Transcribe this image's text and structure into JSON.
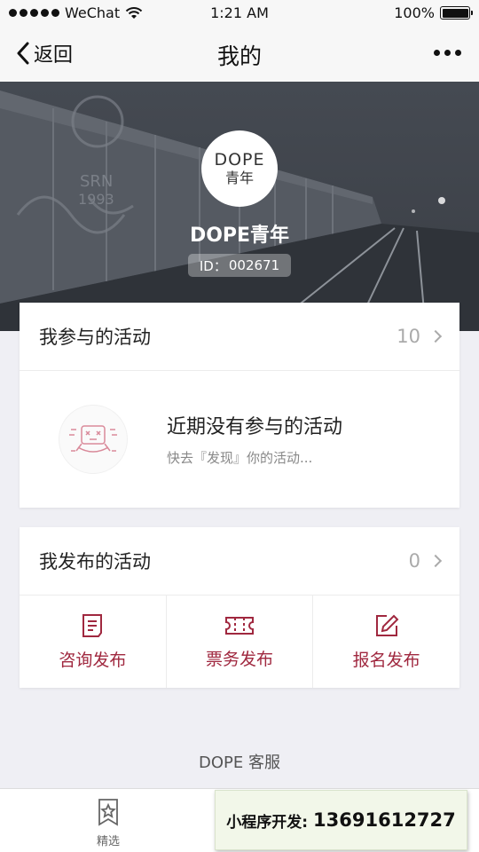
{
  "status_bar": {
    "carrier": "WeChat",
    "time": "1:21 AM",
    "battery": "100%"
  },
  "nav": {
    "back_label": "返回",
    "title": "我的"
  },
  "profile": {
    "avatar_line1": "DOPE",
    "avatar_line2": "青年",
    "username": "DOPE青年",
    "id_label": "ID：",
    "id_value": "002671"
  },
  "participated": {
    "title": "我参与的活动",
    "count": "10",
    "empty_title": "近期没有参与的活动",
    "empty_subtitle": "快去『发现』你的活动..."
  },
  "published": {
    "title": "我发布的活动",
    "count": "0",
    "actions": [
      {
        "label": "咨询发布",
        "icon": "document-icon"
      },
      {
        "label": "票务发布",
        "icon": "ticket-icon"
      },
      {
        "label": "报名发布",
        "icon": "edit-icon"
      }
    ]
  },
  "footer": {
    "service_label": "DOPE 客服"
  },
  "tabbar": {
    "tabs": [
      {
        "label": "精选",
        "icon": "bookmark-star-icon"
      }
    ]
  },
  "overlay": {
    "label": "小程序开发:",
    "phone": "13691612727"
  },
  "colors": {
    "accent": "#a0283f",
    "hero_bg": "#3f444c"
  }
}
